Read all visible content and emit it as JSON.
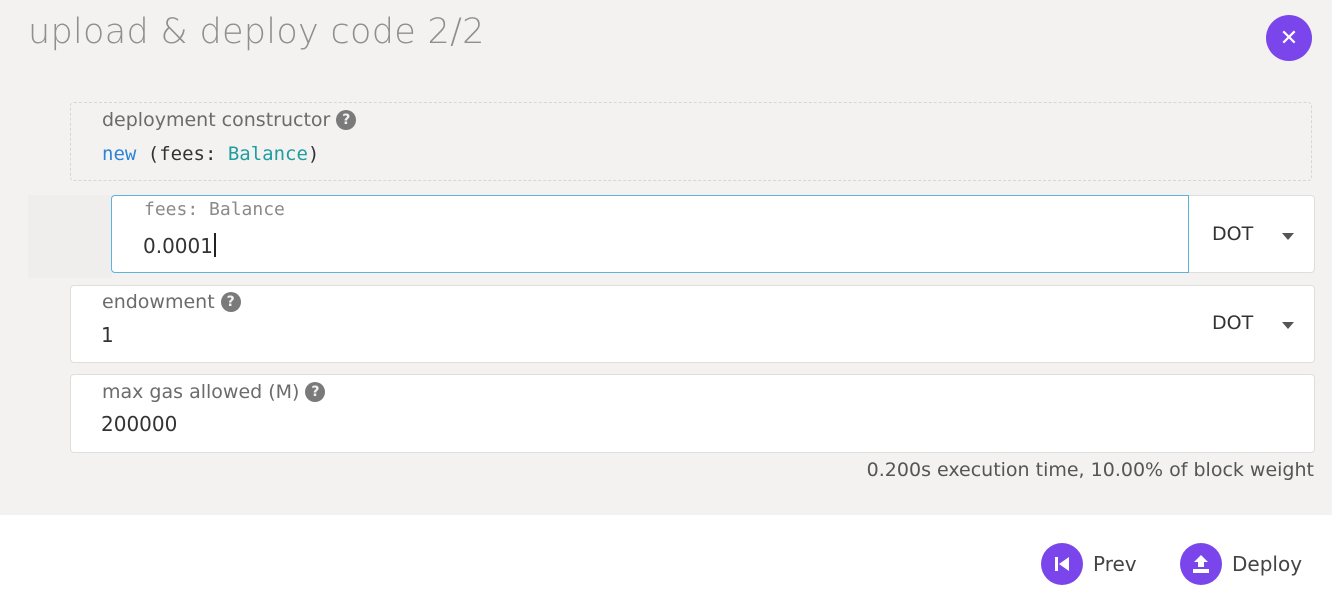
{
  "modal": {
    "title": "upload & deploy code 2/2",
    "close_icon": "close-icon",
    "close_glyph": "✕"
  },
  "constructor": {
    "label": "deployment constructor",
    "help_glyph": "?",
    "signature": {
      "keyword": "new",
      "open": " (fees: ",
      "type": "Balance",
      "close": ")"
    }
  },
  "fees": {
    "label": "fees: Balance",
    "value": "0.0001",
    "unit": "DOT"
  },
  "endowment": {
    "label": "endowment",
    "value": "1",
    "unit": "DOT"
  },
  "gas": {
    "label": "max gas allowed (M)",
    "value": "200000",
    "hint": "0.200s execution time, 10.00% of block weight"
  },
  "actions": {
    "prev_label": "Prev",
    "prev_icon": "skip-back-icon",
    "deploy_label": "Deploy",
    "deploy_icon": "upload-icon"
  },
  "colors": {
    "accent": "#7b45ec",
    "focus_border": "#5fb2d9",
    "keyword": "#2b84d8",
    "type": "#1f9ea0"
  }
}
